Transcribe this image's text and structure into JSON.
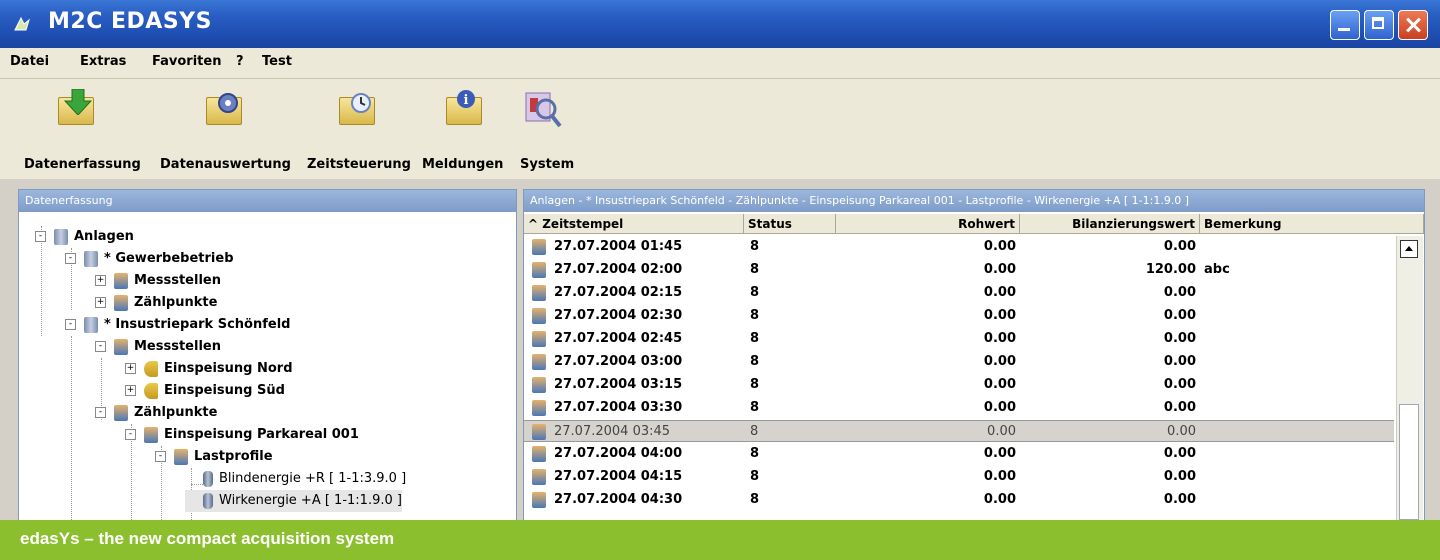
{
  "window": {
    "title": "M2C EDASYS"
  },
  "menu": [
    "Datei",
    "Extras",
    "Favoriten",
    "?",
    "Test"
  ],
  "toolbar": [
    {
      "label": "Datenerfassung",
      "icon": "folder-green-arrow-icon"
    },
    {
      "label": "Datenauswertung",
      "icon": "folder-gear-icon"
    },
    {
      "label": "Zeitsteuerung",
      "icon": "folder-clock-icon"
    },
    {
      "label": "Meldungen",
      "icon": "folder-info-icon"
    },
    {
      "label": "System",
      "icon": "system-search-icon"
    }
  ],
  "left_pane": {
    "header": "Datenerfassung",
    "tree": [
      {
        "label": "Anlagen",
        "icon": "database-icon",
        "level": 0,
        "expander": "-"
      },
      {
        "label": "* Gewerbebetrieb",
        "icon": "database-icon",
        "level": 1,
        "expander": "-"
      },
      {
        "label": "Messstellen",
        "icon": "person-icon",
        "level": 2,
        "expander": "+"
      },
      {
        "label": "Zählpunkte",
        "icon": "person-icon",
        "level": 2,
        "expander": "+"
      },
      {
        "label": "* Insustriepark Schönfeld",
        "icon": "database-icon",
        "level": 1,
        "expander": "-"
      },
      {
        "label": "Messstellen",
        "icon": "person-icon",
        "level": 2,
        "expander": "-"
      },
      {
        "label": "Einspeisung Nord",
        "icon": "key-icon",
        "level": 3,
        "expander": "+"
      },
      {
        "label": "Einspeisung Süd",
        "icon": "key-icon",
        "level": 3,
        "expander": "+"
      },
      {
        "label": "Zählpunkte",
        "icon": "person-icon",
        "level": 2,
        "expander": "-"
      },
      {
        "label": "Einspeisung Parkareal 001",
        "icon": "person-icon",
        "level": 3,
        "expander": "-"
      },
      {
        "label": "Lastprofile",
        "icon": "person-icon",
        "level": 4,
        "expander": "-"
      },
      {
        "label": "Blindenergie +R  [ 1-1:3.9.0 ]",
        "icon": "meter-icon",
        "level": 5,
        "expander": ""
      },
      {
        "label": "Wirkenergie +A  [ 1-1:1.9.0 ]",
        "icon": "meter-icon",
        "level": 5,
        "expander": "",
        "selected": true
      }
    ]
  },
  "right_pane": {
    "header": "Anlagen - * Insustriepark Schönfeld - Zählpunkte - Einspeisung Parkareal 001 - Lastprofile - Wirkenergie +A  [ 1-1:1.9.0 ]",
    "columns": [
      "^ Zeitstempel",
      "Status",
      "Rohwert",
      "Bilanzierungswert",
      "Bemerkung"
    ],
    "rows": [
      {
        "ts": "27.07.2004 01:45",
        "status": "8",
        "roh": "0.00",
        "bil": "0.00",
        "bem": ""
      },
      {
        "ts": "27.07.2004 02:00",
        "status": "8",
        "roh": "0.00",
        "bil": "120.00",
        "bem": "abc"
      },
      {
        "ts": "27.07.2004 02:15",
        "status": "8",
        "roh": "0.00",
        "bil": "0.00",
        "bem": ""
      },
      {
        "ts": "27.07.2004 02:30",
        "status": "8",
        "roh": "0.00",
        "bil": "0.00",
        "bem": ""
      },
      {
        "ts": "27.07.2004 02:45",
        "status": "8",
        "roh": "0.00",
        "bil": "0.00",
        "bem": ""
      },
      {
        "ts": "27.07.2004 03:00",
        "status": "8",
        "roh": "0.00",
        "bil": "0.00",
        "bem": ""
      },
      {
        "ts": "27.07.2004 03:15",
        "status": "8",
        "roh": "0.00",
        "bil": "0.00",
        "bem": ""
      },
      {
        "ts": "27.07.2004 03:30",
        "status": "8",
        "roh": "0.00",
        "bil": "0.00",
        "bem": ""
      },
      {
        "ts": "27.07.2004 03:45",
        "status": "8",
        "roh": "0.00",
        "bil": "0.00",
        "bem": "",
        "selected": true
      },
      {
        "ts": "27.07.2004 04:00",
        "status": "8",
        "roh": "0.00",
        "bil": "0.00",
        "bem": ""
      },
      {
        "ts": "27.07.2004 04:15",
        "status": "8",
        "roh": "0.00",
        "bil": "0.00",
        "bem": ""
      },
      {
        "ts": "27.07.2004 04:30",
        "status": "8",
        "roh": "0.00",
        "bil": "0.00",
        "bem": ""
      }
    ]
  },
  "caption": "edasYs – the new compact acquisition system",
  "colors": {
    "titlebar": "#2a5fc4",
    "banner": "#8cbf2e",
    "pane_header": "#8aa6d0"
  }
}
